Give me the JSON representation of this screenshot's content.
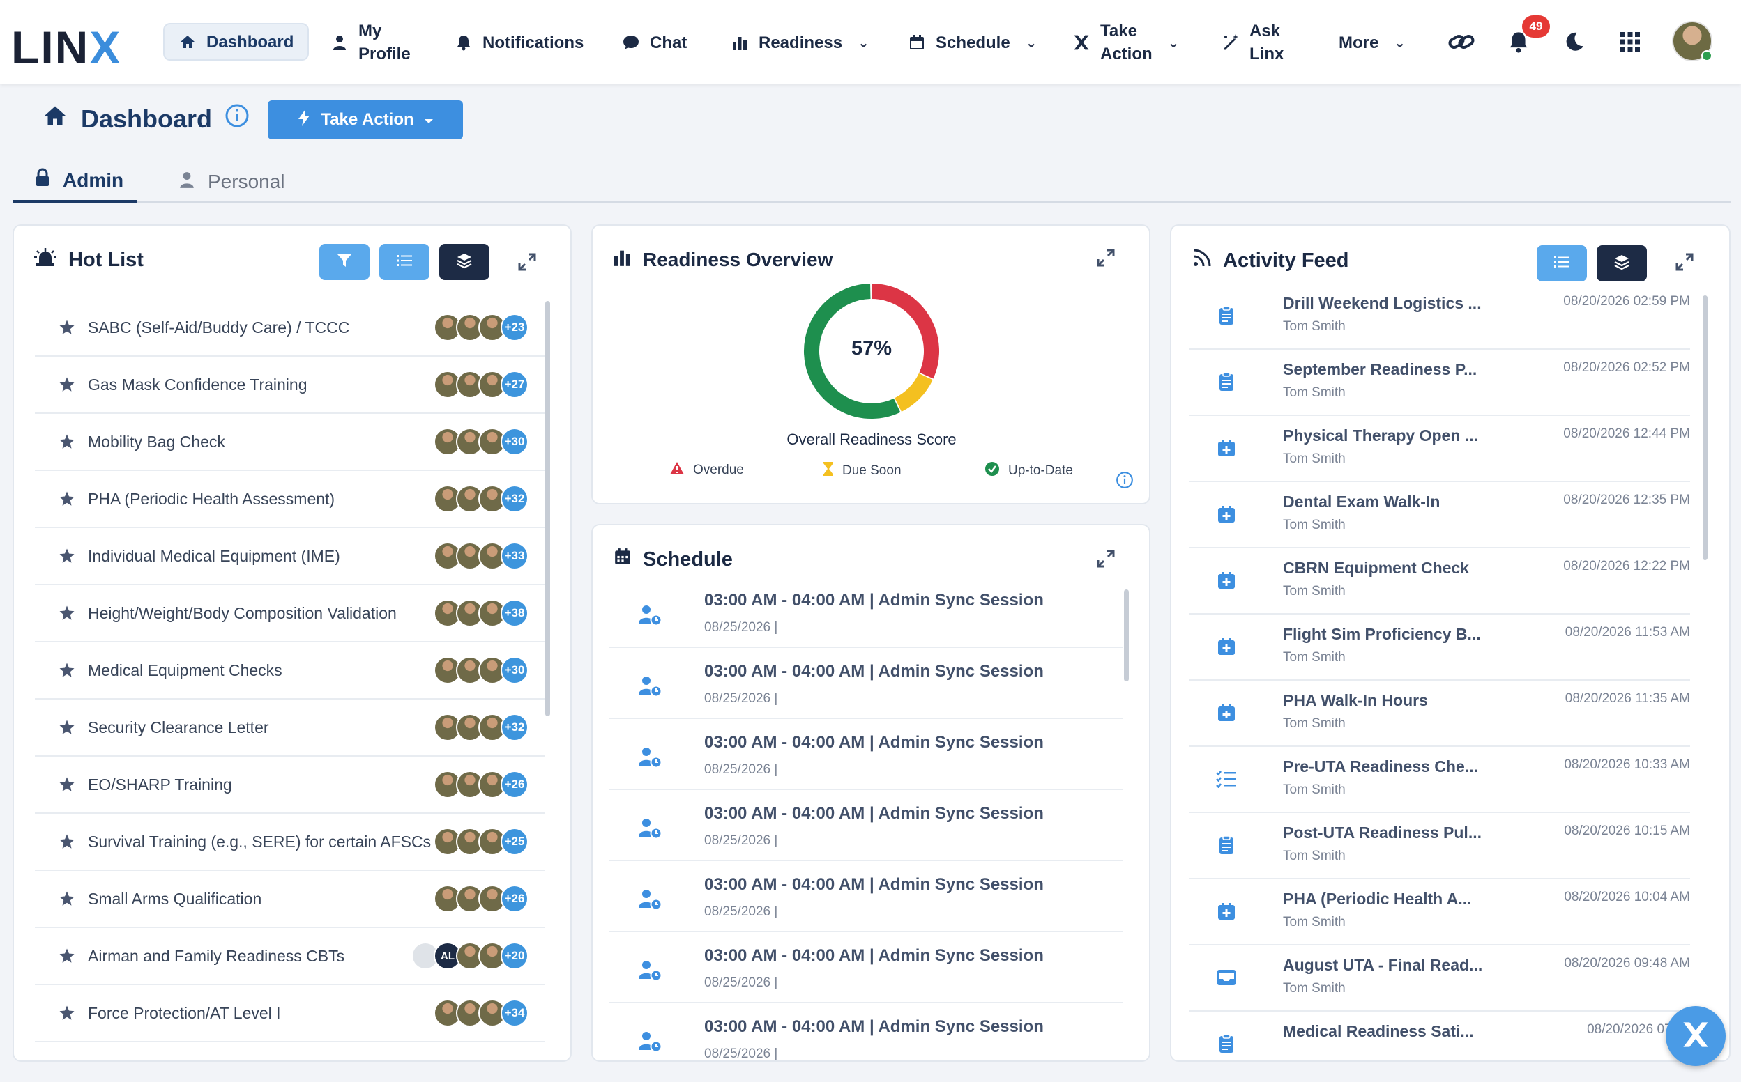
{
  "brand": {
    "logo_main": "LIN",
    "logo_x": "X"
  },
  "nav": {
    "dashboard": "Dashboard",
    "my_profile_1": "My",
    "my_profile_2": "Profile",
    "notifications": "Notifications",
    "chat": "Chat",
    "readiness": "Readiness",
    "schedule": "Schedule",
    "take_action_1": "Take",
    "take_action_2": "Action",
    "ask_linx_1": "Ask",
    "ask_linx_2": "Linx",
    "more": "More",
    "notification_count": "49"
  },
  "page": {
    "title": "Dashboard",
    "take_action_button": "Take Action",
    "tabs": {
      "admin": "Admin",
      "personal": "Personal"
    }
  },
  "hot_list": {
    "title": "Hot List",
    "items": [
      {
        "name": "SABC (Self-Aid/Buddy Care) / TCCC",
        "count": "+23"
      },
      {
        "name": "Gas Mask Confidence Training",
        "count": "+27"
      },
      {
        "name": "Mobility Bag Check",
        "count": "+30"
      },
      {
        "name": "PHA (Periodic Health Assessment)",
        "count": "+32"
      },
      {
        "name": "Individual Medical Equipment (IME)",
        "count": "+33"
      },
      {
        "name": "Height/Weight/Body Composition Validation",
        "count": "+38"
      },
      {
        "name": "Medical Equipment Checks",
        "count": "+30"
      },
      {
        "name": "Security Clearance Letter",
        "count": "+32"
      },
      {
        "name": "EO/SHARP Training",
        "count": "+26"
      },
      {
        "name": "Survival Training (e.g., SERE) for certain AFSCs",
        "count": "+25"
      },
      {
        "name": "Small Arms Qualification",
        "count": "+26"
      },
      {
        "name": "Airman and Family Readiness CBTs",
        "count": "+20",
        "initials": "AL"
      },
      {
        "name": "Force Protection/AT Level I",
        "count": "+34"
      }
    ]
  },
  "readiness": {
    "title": "Readiness Overview",
    "score": "57%",
    "score_label": "Overall Readiness Score",
    "breakdown": {
      "up_to_date": 57,
      "due_soon": 11,
      "overdue": 32
    },
    "colors": {
      "up_to_date": "#1e8f4e",
      "due_soon": "#f4c020",
      "overdue": "#dc3545"
    },
    "legend": {
      "overdue": "Overdue",
      "due_soon": "Due Soon",
      "up_to_date": "Up-to-Date"
    }
  },
  "schedule": {
    "title": "Schedule",
    "items": [
      {
        "title": "03:00 AM - 04:00 AM | Admin Sync Session",
        "date": "08/25/2026 |"
      },
      {
        "title": "03:00 AM - 04:00 AM | Admin Sync Session",
        "date": "08/25/2026 |"
      },
      {
        "title": "03:00 AM - 04:00 AM | Admin Sync Session",
        "date": "08/25/2026 |"
      },
      {
        "title": "03:00 AM - 04:00 AM | Admin Sync Session",
        "date": "08/25/2026 |"
      },
      {
        "title": "03:00 AM - 04:00 AM | Admin Sync Session",
        "date": "08/25/2026 |"
      },
      {
        "title": "03:00 AM - 04:00 AM | Admin Sync Session",
        "date": "08/25/2026 |"
      },
      {
        "title": "03:00 AM - 04:00 AM | Admin Sync Session",
        "date": "08/25/2026 |"
      }
    ]
  },
  "activity": {
    "title": "Activity Feed",
    "items": [
      {
        "title": "Drill Weekend Logistics ...",
        "user": "Tom Smith",
        "date": "08/20/2026 02:59 PM",
        "icon": "clipboard-icon"
      },
      {
        "title": "September Readiness P...",
        "user": "Tom Smith",
        "date": "08/20/2026 02:52 PM",
        "icon": "clipboard-icon"
      },
      {
        "title": "Physical Therapy Open ...",
        "user": "Tom Smith",
        "date": "08/20/2026 12:44 PM",
        "icon": "calendar-plus-icon"
      },
      {
        "title": "Dental Exam Walk-In",
        "user": "Tom Smith",
        "date": "08/20/2026 12:35 PM",
        "icon": "calendar-plus-icon"
      },
      {
        "title": "CBRN Equipment Check",
        "user": "Tom Smith",
        "date": "08/20/2026 12:22 PM",
        "icon": "calendar-plus-icon"
      },
      {
        "title": "Flight Sim Proficiency B...",
        "user": "Tom Smith",
        "date": "08/20/2026 11:53 AM",
        "icon": "calendar-plus-icon"
      },
      {
        "title": "PHA Walk-In Hours",
        "user": "Tom Smith",
        "date": "08/20/2026 11:35 AM",
        "icon": "calendar-plus-icon"
      },
      {
        "title": "Pre-UTA Readiness Che...",
        "user": "Tom Smith",
        "date": "08/20/2026 10:33 AM",
        "icon": "checklist-icon"
      },
      {
        "title": "Post-UTA Readiness Pul...",
        "user": "Tom Smith",
        "date": "08/20/2026 10:15 AM",
        "icon": "clipboard-icon"
      },
      {
        "title": "PHA (Periodic Health A...",
        "user": "Tom Smith",
        "date": "08/20/2026 10:04 AM",
        "icon": "calendar-plus-icon"
      },
      {
        "title": "August UTA - Final Read...",
        "user": "Tom Smith",
        "date": "08/20/2026 09:48 AM",
        "icon": "inbox-icon"
      },
      {
        "title": "Medical Readiness Sati...",
        "user": "",
        "date": "08/20/2026 07:58",
        "icon": "clipboard-icon"
      }
    ]
  }
}
